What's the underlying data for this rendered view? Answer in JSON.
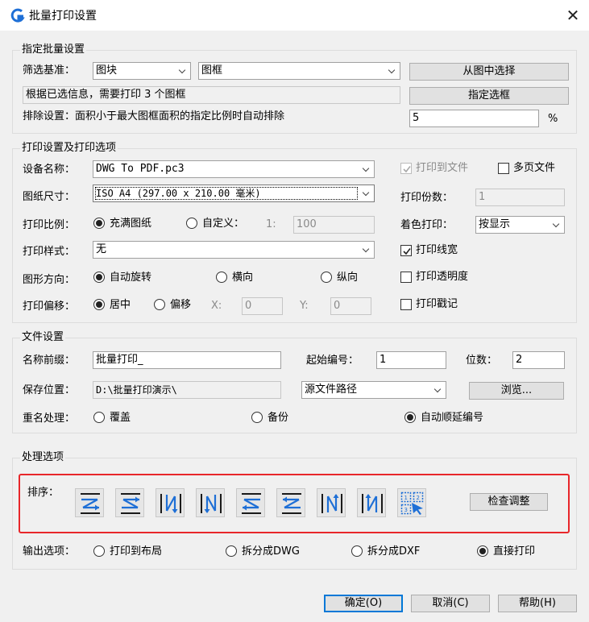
{
  "window": {
    "title": "批量打印设置"
  },
  "batch": {
    "group_title": "指定批量设置",
    "filter_label": "筛选基准：",
    "filter_type": "图块",
    "filter_value": "图框",
    "select_from_drawing_button": "从图中选择",
    "info_text": "根据已选信息，需要打印 3 个图框",
    "specify_frame_button": "指定选框",
    "exclude_text": "排除设置：面积小于最大图框面积的指定比例时自动排除",
    "exclude_value": "5",
    "exclude_unit": "%"
  },
  "print": {
    "group_title": "打印设置及打印选项",
    "device_label": "设备名称：",
    "device_value": "DWG To PDF.pc3",
    "paper_label": "图纸尺寸：",
    "paper_value": "ISO A4 (297.00 x 210.00 毫米)",
    "scale_label": "打印比例：",
    "scale_fit": "充满图纸",
    "scale_custom": "自定义：",
    "scale_ratio_prefix": "1:",
    "scale_value": "100",
    "style_label": "打印样式：",
    "style_value": "无",
    "orient_label": "图形方向：",
    "orient_auto": "自动旋转",
    "orient_landscape": "横向",
    "orient_portrait": "纵向",
    "offset_label": "打印偏移：",
    "offset_center": "居中",
    "offset_offset": "偏移",
    "offset_x_label": "X:",
    "offset_x_value": "0",
    "offset_y_label": "Y:",
    "offset_y_value": "0",
    "print_to_file": "打印到文件",
    "multi_page": "多页文件",
    "copies_label": "打印份数：",
    "copies_value": "1",
    "color_label": "着色打印：",
    "color_value": "按显示",
    "lineweight": "打印线宽",
    "transparency": "打印透明度",
    "stamp": "打印戳记"
  },
  "file": {
    "group_title": "文件设置",
    "prefix_label": "名称前缀：",
    "prefix_value": "批量打印_",
    "start_label": "起始编号：",
    "start_value": "1",
    "digits_label": "位数：",
    "digits_value": "2",
    "location_label": "保存位置：",
    "location_value": "D:\\批量打印演示\\",
    "path_type_value": "源文件路径",
    "browse_button": "浏览...",
    "rename_label": "重名处理：",
    "rename_overwrite": "覆盖",
    "rename_backup": "备份",
    "rename_auto": "自动顺延编号"
  },
  "process": {
    "group_title": "处理选项",
    "sort_label": "排序：",
    "check_button": "检查调整",
    "output_label": "输出选项：",
    "output_layout": "打印到布局",
    "output_split_dwg": "拆分成DWG",
    "output_split_dxf": "拆分成DXF",
    "output_direct": "直接打印"
  },
  "footer": {
    "ok": "确定(O)",
    "cancel": "取消(C)",
    "help": "帮助(H)"
  },
  "colors": {
    "accent": "#0078d7",
    "highlight": "#e8262a",
    "icon_blue": "#1e6fd6"
  }
}
